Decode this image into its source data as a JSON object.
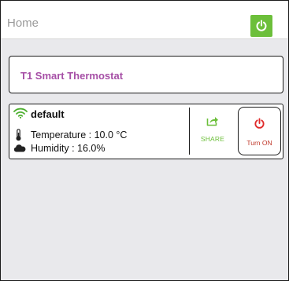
{
  "header": {
    "title": "Home",
    "power_icon": "power-icon",
    "accent": "#6cbf3a"
  },
  "device_title": "T1 Smart Thermostat",
  "device": {
    "name": "default",
    "wifi_icon": "wifi-icon",
    "temperature": "Temperature : 10.0 °C",
    "humidity": "Humidity : 16.0%",
    "share_label": "SHARE",
    "turn_on_label": "Turn ON"
  },
  "colors": {
    "title_purple": "#a64fa6",
    "share_green": "#6cbf3a",
    "power_red": "#e02b2b",
    "background": "#e9e9ec"
  }
}
